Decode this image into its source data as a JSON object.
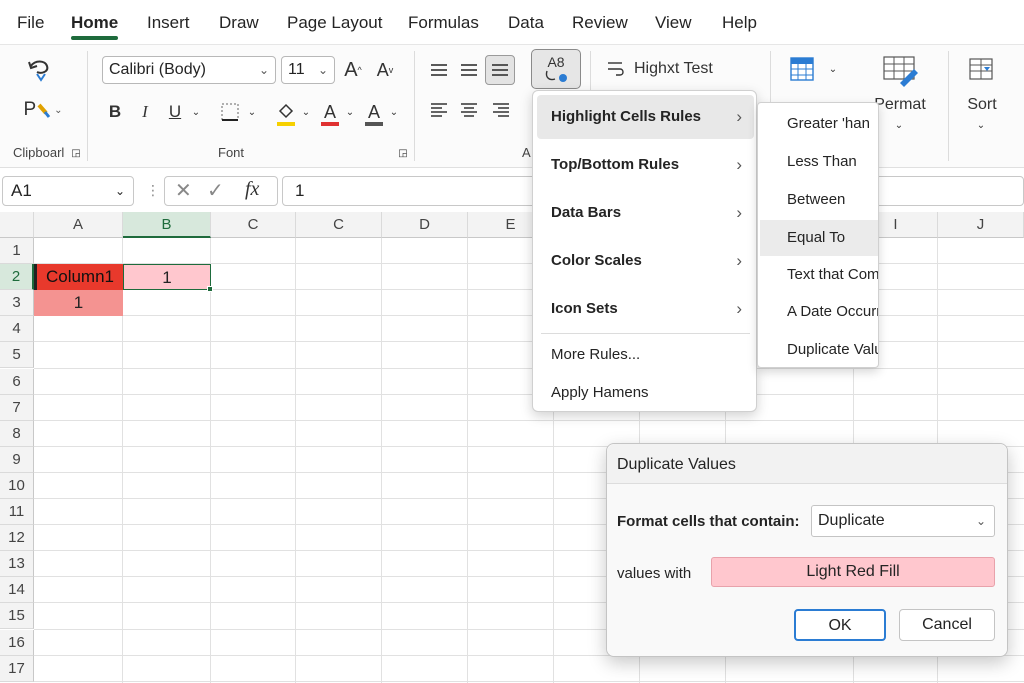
{
  "menu_tabs": [
    "File",
    "Home",
    "Insert",
    "Draw",
    "Page Layout",
    "Formulas",
    "Data",
    "Review",
    "View",
    "Help"
  ],
  "active_tab": "Home",
  "ribbon": {
    "clipboard_label": "Clipboarl",
    "paste_label": "P",
    "font_name": "Calibri (Body)",
    "font_size": "11",
    "grow_font": "A",
    "shrink_font": "A",
    "bold": "B",
    "italic": "I",
    "underline": "U",
    "font_color_letter": "A",
    "highlight_letter": "A",
    "font_group_label": "Font",
    "alignment_label_partial": "A",
    "cf_button_text": "A8",
    "wrap_text_label": "Highxt Test",
    "format_label": "Permat",
    "sort_label": "Sort",
    "colors": {
      "font_color": "#e03131",
      "highlight": "#f6d000",
      "accent": "#1e6b3c"
    }
  },
  "formula_bar": {
    "name_box": "A1",
    "fx": "fx",
    "value": "1"
  },
  "sheet": {
    "columns": [
      "A",
      "B",
      "C",
      "C",
      "D",
      "E",
      "",
      "",
      "",
      "I",
      "J"
    ],
    "rows": [
      "1",
      "2",
      "3",
      "4",
      "5",
      "6",
      "7",
      "8",
      "9",
      "10",
      "11",
      "12",
      "13",
      "14",
      "15",
      "16",
      "17"
    ],
    "selected_column": "B",
    "selected_row": "2",
    "cells": {
      "A2": "Column1",
      "B2": "1",
      "A3": "1"
    },
    "fill_colors": {
      "A2": "#e8392c",
      "B2": "#ffc7ce",
      "A3": "#f49391"
    }
  },
  "conditional_menu": {
    "items": [
      {
        "label": "Highlight Cells Rules",
        "has_submenu": true
      },
      {
        "label": "Top/Bottom Rules",
        "has_submenu": true
      },
      {
        "label": "Data Bars",
        "has_submenu": true
      },
      {
        "label": "Color Scales",
        "has_submenu": true
      },
      {
        "label": "Icon Sets",
        "has_submenu": true
      },
      {
        "label": "More Rules...",
        "has_submenu": false
      },
      {
        "label": "Apply Hamens",
        "has_submenu": false
      }
    ],
    "submenu_arrow": "›"
  },
  "submenu": {
    "items": [
      "Greater 'han",
      "Less Than",
      "Between",
      "Equal To",
      "Text that Com",
      "A Date Occurr",
      "Duplicate Valu"
    ]
  },
  "dialog": {
    "title": "Duplicate Values",
    "format_label": "Format cells that contain:",
    "type_value": "Duplicate",
    "values_with_label": "values with",
    "format_value": "Light Red Fill",
    "ok_label": "OK",
    "cancel_label": "Cancel"
  }
}
